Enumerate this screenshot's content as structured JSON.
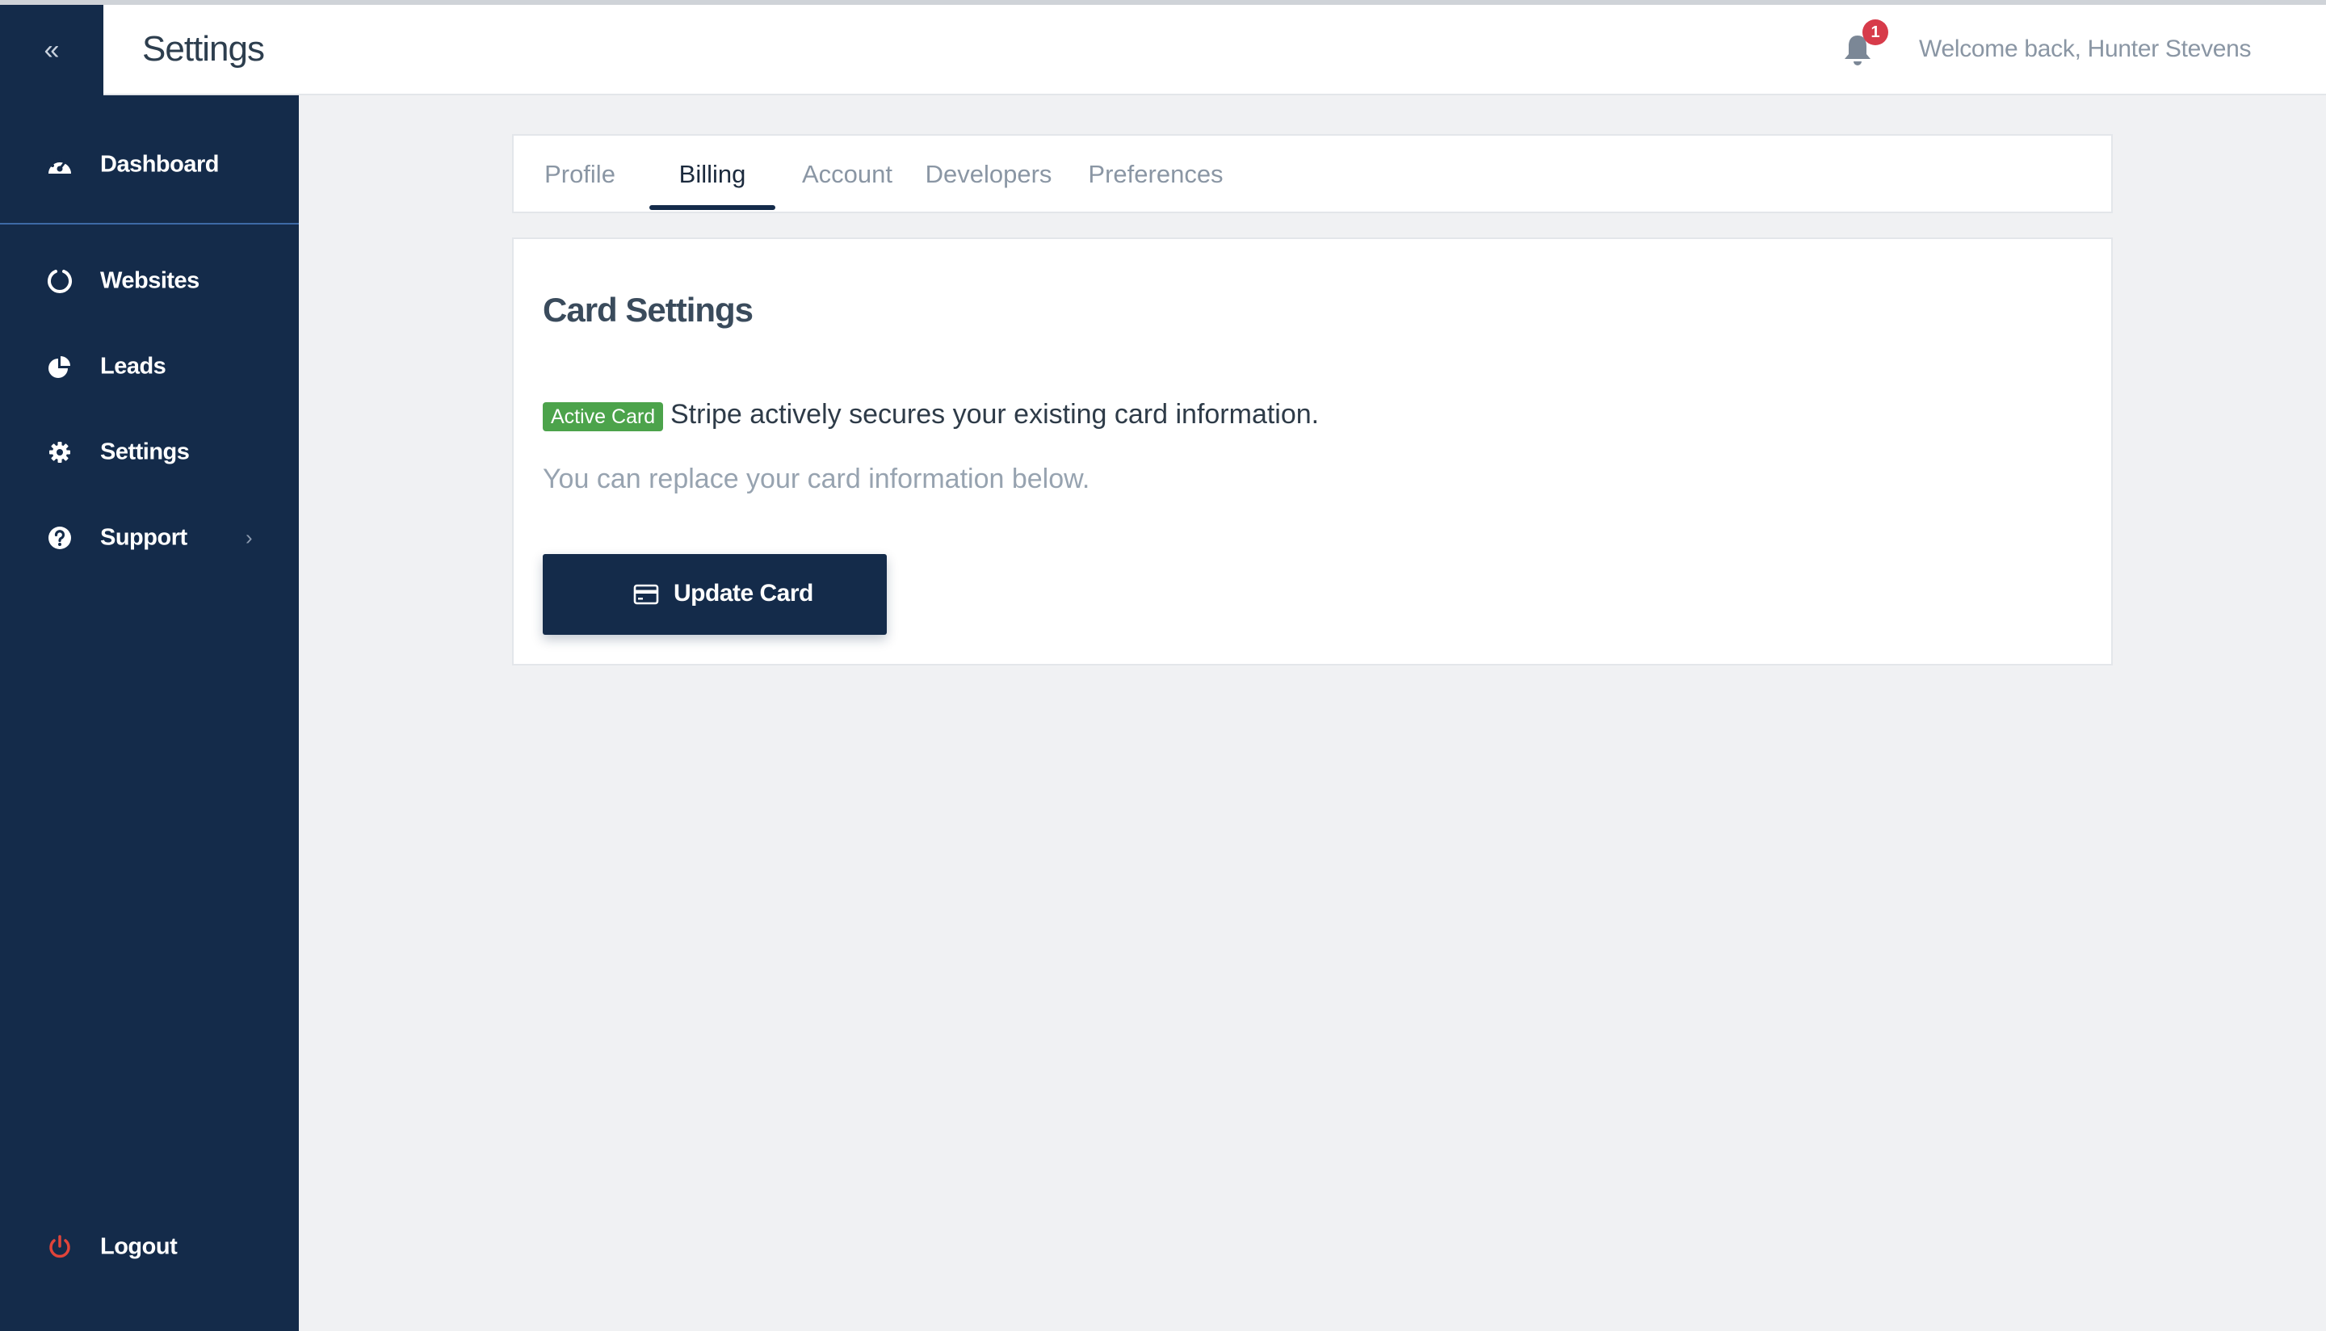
{
  "header": {
    "title": "Settings",
    "notification_count": "1",
    "welcome_text": "Welcome back, Hunter Stevens"
  },
  "sidebar": {
    "items": [
      {
        "label": "Dashboard",
        "icon": "speedometer-icon"
      },
      {
        "label": "Websites",
        "icon": "circle-notch-icon"
      },
      {
        "label": "Leads",
        "icon": "pie-chart-icon"
      },
      {
        "label": "Settings",
        "icon": "gear-icon"
      },
      {
        "label": "Support",
        "icon": "question-circle-icon"
      }
    ],
    "logout_label": "Logout"
  },
  "tabs": {
    "items": [
      "Profile",
      "Billing",
      "Account",
      "Developers",
      "Preferences"
    ],
    "active": "Billing"
  },
  "card_settings": {
    "title": "Card Settings",
    "badge": "Active Card",
    "secure_text": "Stripe actively secures your existing card information.",
    "replace_text": "You can replace your card information below.",
    "button_label": "Update Card"
  },
  "colors": {
    "sidebar_bg": "#142b4a",
    "badge_green": "#4ca34b",
    "logout_red": "#e0443a",
    "notification_red": "#d73b4a"
  }
}
